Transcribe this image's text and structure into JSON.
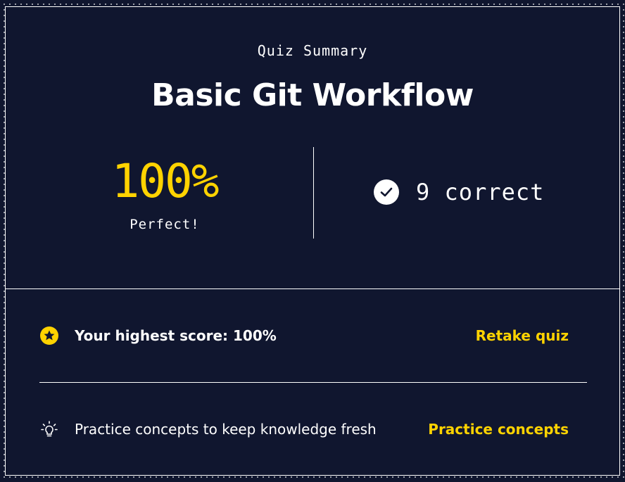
{
  "summary": {
    "eyebrow": "Quiz Summary",
    "title": "Basic Git Workflow",
    "score": "100%",
    "score_label": "Perfect!",
    "correct_text": "9 correct"
  },
  "highest": {
    "text": "Your highest score: 100%",
    "link": "Retake quiz",
    "icon": "star-badge-icon"
  },
  "practice": {
    "text": "Practice concepts to keep knowledge fresh",
    "link": "Practice concepts",
    "icon": "lightbulb-icon"
  },
  "colors": {
    "background": "#10162f",
    "accent": "#ffd300",
    "text": "#ffffff"
  }
}
